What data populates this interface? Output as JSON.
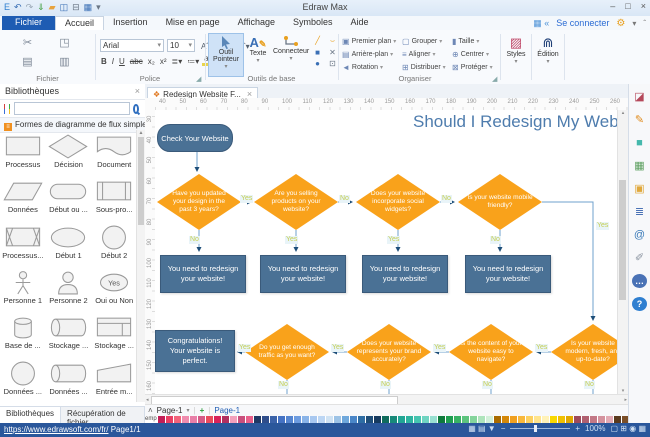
{
  "titlebar": {
    "title": "Edraw Max",
    "minimize": "–",
    "maximize": "□",
    "close": "×"
  },
  "qat": [
    {
      "name": "app-logo-icon",
      "g": "E",
      "c": "#2f7fd0"
    },
    {
      "name": "undo-icon",
      "g": "↶",
      "c": "#3a6fb5"
    },
    {
      "name": "redo-icon",
      "g": "↷",
      "c": "#9aa7b5"
    },
    {
      "name": "import-icon",
      "g": "⇓",
      "c": "#3f9e3f"
    },
    {
      "name": "open-folder-icon",
      "g": "▰",
      "c": "#e8a33d"
    },
    {
      "name": "save-icon",
      "g": "◫",
      "c": "#3a6fb5"
    },
    {
      "name": "print-icon",
      "g": "⊟",
      "c": "#6a7685"
    },
    {
      "name": "export-icon",
      "g": "▦",
      "c": "#3a6fb5"
    },
    {
      "name": "qat-more-icon",
      "g": "▾",
      "c": "#6a7685"
    }
  ],
  "menu": {
    "tabs": [
      "Fichier",
      "Accueil",
      "Insertion",
      "Mise en page",
      "Affichage",
      "Symboles",
      "Aide"
    ],
    "connect": "Se connecter",
    "header_icons": [
      {
        "name": "snapshot-icon",
        "g": "▦"
      },
      {
        "name": "share-icon",
        "g": "«"
      }
    ]
  },
  "ribbon": {
    "groups": {
      "g1": "Fichier",
      "g2": "Police",
      "g3": "Outils de base",
      "g4": "Organiser"
    },
    "clipboard_icons": [
      "✂",
      "◳",
      "▤",
      "▥"
    ],
    "font_family": "Arial",
    "font_size": "10",
    "font_icons_row1": [
      "Aˆ",
      "Aˇ",
      "▦▾",
      "⌒▾"
    ],
    "font_icons_row2": [
      "B",
      "I",
      "U",
      "abc",
      "x₂",
      "x²",
      "≣▾",
      "≔▾",
      "ab▾",
      "A▾"
    ],
    "pointer_label": "Outil Pointeur",
    "text_label": "Texte",
    "connector_label": "Connecteur",
    "shape_icons": [
      "╱",
      "⌣",
      "■",
      "✕",
      "●",
      "⊡"
    ],
    "organiser_col1": [
      {
        "g": "▣",
        "label": "Premier plan"
      },
      {
        "g": "▤",
        "label": "Arrière-plan"
      },
      {
        "g": "◄",
        "label": "Rotation"
      }
    ],
    "organiser_col2": [
      {
        "g": "▢",
        "label": "Grouper"
      },
      {
        "g": "≡",
        "label": "Aligner"
      },
      {
        "g": "⊞",
        "label": "Distribuer"
      }
    ],
    "organiser_col3": [
      {
        "g": "▮",
        "label": "Taille"
      },
      {
        "g": "⊕",
        "label": "Centrer"
      },
      {
        "g": "⊠",
        "label": "Protéger"
      }
    ],
    "styles_label": "Styles",
    "edition_label": "Édition"
  },
  "library": {
    "title": "Bibliothèques",
    "section": "Formes de diagramme de flux simple",
    "search_placeholder": "",
    "tabs": [
      "Bibliothèques",
      "Récupération de fichier"
    ],
    "shapes": [
      {
        "label": "Processus",
        "shape": "rect"
      },
      {
        "label": "Décision",
        "shape": "diamond"
      },
      {
        "label": "Document",
        "shape": "document"
      },
      {
        "label": "Données",
        "shape": "parallelogram"
      },
      {
        "label": "Début ou ...",
        "shape": "stadium"
      },
      {
        "label": "Sous-pro...",
        "shape": "subprocess"
      },
      {
        "label": "Processus...",
        "shape": "internal"
      },
      {
        "label": "Début 1",
        "shape": "ellipse"
      },
      {
        "label": "Début 2",
        "shape": "circle"
      },
      {
        "label": "Personne 1",
        "shape": "person1"
      },
      {
        "label": "Personne 2",
        "shape": "person2"
      },
      {
        "label": "Oui ou Non",
        "shape": "yesoval"
      },
      {
        "label": "Base de ...",
        "shape": "cylv"
      },
      {
        "label": "Stockage ...",
        "shape": "cylh"
      },
      {
        "label": "Stockage ...",
        "shape": "stored"
      },
      {
        "label": "Données ...",
        "shape": "circle"
      },
      {
        "label": "Données ...",
        "shape": "cylh"
      },
      {
        "label": "Entrée m...",
        "shape": "manual"
      }
    ]
  },
  "canvas": {
    "doc_tab": "Redesign Website F...",
    "ruler_h": [
      40,
      50,
      60,
      70,
      80,
      90,
      100,
      110,
      120,
      130,
      140,
      150,
      160,
      170,
      180,
      190,
      200,
      210,
      220,
      230,
      240,
      250,
      260
    ],
    "ruler_v": [
      30,
      40,
      50,
      60,
      70,
      80,
      90,
      100,
      110,
      120,
      130,
      140,
      150,
      160
    ]
  },
  "flow": {
    "title": "Should I Redesign My Website",
    "start": "Check Your Website",
    "yes": "Yes",
    "no": "No",
    "d1": "Have you updated your design in the past 3 years?",
    "d2": "Are you selling products on your website?",
    "d3": "Does your website incorporate social widgets?",
    "d4": "Is your website mobile friendly?",
    "d5": "Do you get enough traffic as you want?",
    "d6": "Does your website represents your brand accurately?",
    "d7": "Is the content of your website easy to navigate?",
    "d8": "Is your website modern, fresh, and up-to-date?",
    "redesign": "You need to redesign your website!",
    "congrats": "Congratulations! Your website is perfect."
  },
  "pagebar": {
    "collapse": "˄",
    "page_select": "Page-1",
    "dd": "▾",
    "add": "+",
    "active_page": "Page-1"
  },
  "palette_label": "emp",
  "palette_colors": [
    "#c21e56",
    "#e83e62",
    "#f2637a",
    "#f08cae",
    "#e87fa8",
    "#d45a86",
    "#e84c5c",
    "#d8235a",
    "#b03060",
    "#f2a0bc",
    "#c94f7c",
    "#e85f8a",
    "#1f3864",
    "#2e4d8a",
    "#3a62a8",
    "#4472c4",
    "#5585d0",
    "#6d9ce0",
    "#8ab4e8",
    "#a8c8f0",
    "#bcd6f4",
    "#cfe2f3",
    "#9dc3e6",
    "#6fa8dc",
    "#4a86c8",
    "#2e6da4",
    "#1f4e79",
    "#163a5f",
    "#0f6b5c",
    "#17897a",
    "#21a695",
    "#2db3a0",
    "#45c4b0",
    "#6fd4c2",
    "#98e0d2",
    "#0e7a3c",
    "#1e9e50",
    "#38b264",
    "#5cc47e",
    "#84d49c",
    "#aee4bc",
    "#d2f0da",
    "#a86a00",
    "#d4880a",
    "#f0a020",
    "#f8b83c",
    "#fcd060",
    "#ffe48c",
    "#fff2b8",
    "#f8d800",
    "#f0c000",
    "#e0a800",
    "#9e4a5a",
    "#b06070",
    "#c27886",
    "#d4929e",
    "#e2aab4",
    "#5a3a1e",
    "#7a4f28",
    "#9a6632",
    "#b8823e",
    "#d0a05c",
    "#000000",
    "#202020",
    "#404040",
    "#606060",
    "#808080",
    "#a0a0a0",
    "#c0c0c0",
    "#e0e0e0"
  ],
  "right_toolbar": [
    {
      "name": "theme-icon",
      "g": "◪",
      "c": "#b5485a"
    },
    {
      "name": "pen-style-icon",
      "g": "✎",
      "c": "#e08a1a"
    },
    {
      "name": "fill-color-icon",
      "g": "■",
      "c": "#45b8ac"
    },
    {
      "name": "insert-picture-icon",
      "g": "▦",
      "c": "#5a9e5d"
    },
    {
      "name": "copy-pages-icon",
      "g": "▣",
      "c": "#e0a83c"
    },
    {
      "name": "notes-icon",
      "g": "≣",
      "c": "#4a72b5"
    },
    {
      "name": "hyperlink-icon",
      "g": "@",
      "c": "#3a7ab8"
    },
    {
      "name": "attachment-icon",
      "g": "✐",
      "c": "#8a94a0"
    },
    {
      "name": "comment-icon",
      "g": "…",
      "c": "#ffffff",
      "bg": "#4a72b5"
    },
    {
      "name": "help-icon",
      "g": "?",
      "c": "#ffffff",
      "bg": "#2f7fd0"
    }
  ],
  "statusbar": {
    "url": "https://www.edrawsoft.com/fr/",
    "page_indicator": "Page1/1",
    "zoom": "100%",
    "minus": "−",
    "plus": "+",
    "icons_left": [
      "▦",
      "▤",
      "▼"
    ],
    "icons_right": [
      "▢",
      "⊞",
      "◉",
      "▦"
    ]
  }
}
